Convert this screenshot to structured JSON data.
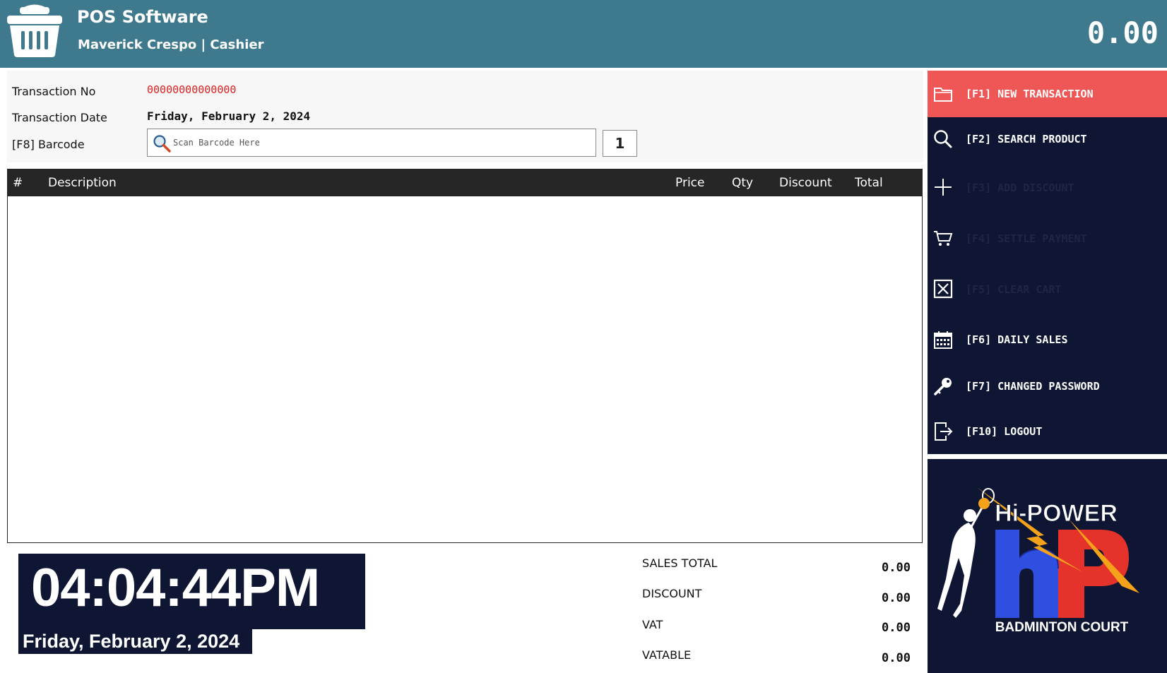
{
  "header": {
    "title": "POS Software",
    "user": "Maverick Crespo | Cashier",
    "grand_total": "0.00"
  },
  "transaction": {
    "no_label": "Transaction No",
    "no_value": "00000000000000",
    "date_label": "Transaction Date",
    "date_value": "Friday, February 2, 2024",
    "barcode_label": "[F8] Barcode",
    "barcode_placeholder": "Scan Barcode Here",
    "qty_value": "1"
  },
  "table": {
    "columns": [
      "#",
      "Description",
      "Price",
      "Qty",
      "Discount",
      "Total"
    ],
    "rows": []
  },
  "menu": {
    "items": [
      {
        "label": "[F1] NEW TRANSACTION",
        "icon": "folder-icon",
        "state": "active"
      },
      {
        "label": "[F2] SEARCH PRODUCT",
        "icon": "search-icon",
        "state": "enabled"
      },
      {
        "label": "[F3] ADD DISCOUNT",
        "icon": "plus-icon",
        "state": "disabled"
      },
      {
        "label": "[F4] SETTLE PAYMENT",
        "icon": "cart-icon",
        "state": "disabled"
      },
      {
        "label": "[F5] CLEAR CART",
        "icon": "close-box-icon",
        "state": "disabled"
      },
      {
        "label": "[F6] DAILY SALES",
        "icon": "calendar-icon",
        "state": "enabled"
      },
      {
        "label": "[F7] CHANGED PASSWORD",
        "icon": "key-icon",
        "state": "enabled"
      },
      {
        "label": "[F10] LOGOUT",
        "icon": "logout-icon",
        "state": "enabled"
      }
    ]
  },
  "brand": {
    "name": "Hi-POWER",
    "monogram": "hP",
    "tagline": "BADMINTON COURT"
  },
  "clock": {
    "time": "04:04:44PM",
    "date": "Friday, February 2, 2024"
  },
  "summary": {
    "sales_total_label": "SALES TOTAL",
    "sales_total_value": "0.00",
    "discount_label": "DISCOUNT",
    "discount_value": "0.00",
    "vat_label": "VAT",
    "vat_value": "0.00",
    "vatable_label": "VATABLE",
    "vatable_value": "0.00"
  },
  "colors": {
    "header_bg": "#3e798d",
    "sidebar_bg": "#0f1634",
    "active_item": "#ef5757",
    "txn_no_text": "#e02020"
  }
}
